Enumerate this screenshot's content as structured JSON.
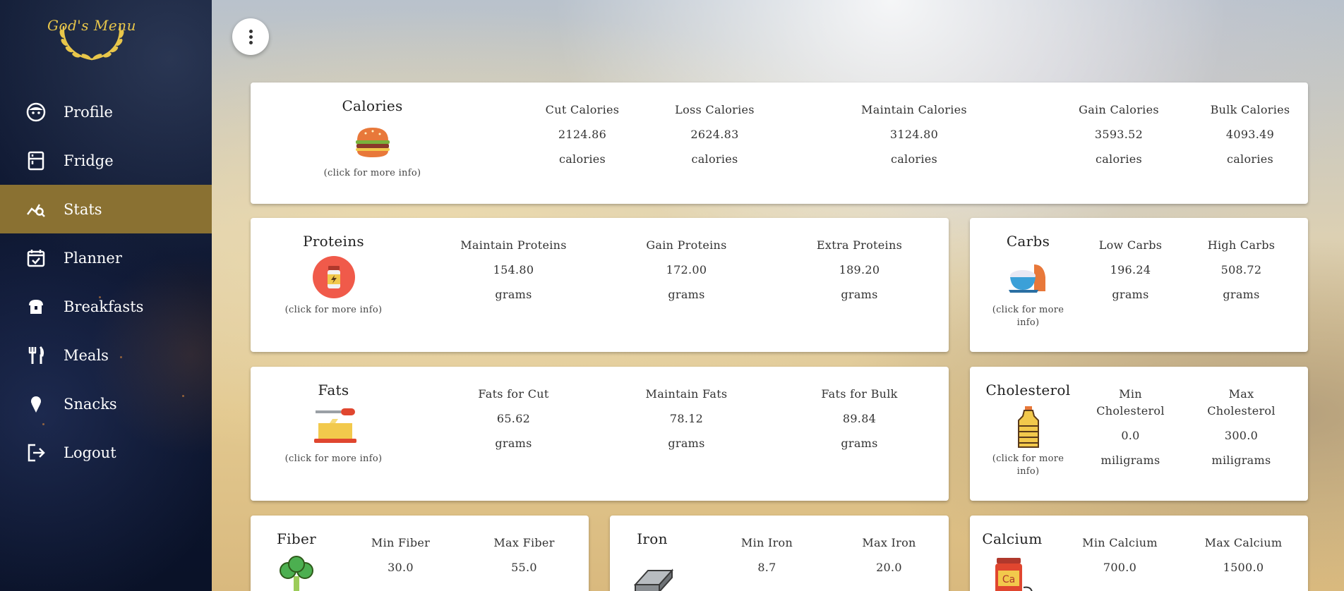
{
  "app": {
    "logo_text": "God's Menu"
  },
  "sidebar": {
    "items": [
      {
        "label": "Profile",
        "icon": "face-icon",
        "active": false
      },
      {
        "label": "Fridge",
        "icon": "fridge-icon",
        "active": false
      },
      {
        "label": "Stats",
        "icon": "stats-icon",
        "active": true
      },
      {
        "label": "Planner",
        "icon": "calendar-check-icon",
        "active": false
      },
      {
        "label": "Breakfasts",
        "icon": "bread-icon",
        "active": false
      },
      {
        "label": "Meals",
        "icon": "fork-knife-icon",
        "active": false
      },
      {
        "label": "Snacks",
        "icon": "ice-cream-icon",
        "active": false
      },
      {
        "label": "Logout",
        "icon": "logout-icon",
        "active": false
      }
    ]
  },
  "colors": {
    "active_nav": "#8a7132",
    "logo_gold": "#e8c64a",
    "sidebar_bg": "#0d1630"
  },
  "more_info": "(click for more info)",
  "calories": {
    "title": "Calories",
    "cols": [
      {
        "label": "Cut Calories",
        "value": "2124.86",
        "unit": "calories"
      },
      {
        "label": "Loss Calories",
        "value": "2624.83",
        "unit": "calories"
      },
      {
        "label": "Maintain Calories",
        "value": "3124.80",
        "unit": "calories"
      },
      {
        "label": "Gain Calories",
        "value": "3593.52",
        "unit": "calories"
      },
      {
        "label": "Bulk Calories",
        "value": "4093.49",
        "unit": "calories"
      }
    ]
  },
  "proteins": {
    "title": "Proteins",
    "cols": [
      {
        "label": "Maintain Proteins",
        "value": "154.80",
        "unit": "grams"
      },
      {
        "label": "Gain Proteins",
        "value": "172.00",
        "unit": "grams"
      },
      {
        "label": "Extra Proteins",
        "value": "189.20",
        "unit": "grams"
      }
    ]
  },
  "carbs": {
    "title": "Carbs",
    "more_line1": "(click for more",
    "more_line2": "info)",
    "cols": [
      {
        "label": "Low Carbs",
        "value": "196.24",
        "unit": "grams"
      },
      {
        "label": "High Carbs",
        "value": "508.72",
        "unit": "grams"
      }
    ]
  },
  "fats": {
    "title": "Fats",
    "cols": [
      {
        "label": "Fats for Cut",
        "value": "65.62",
        "unit": "grams"
      },
      {
        "label": "Maintain Fats",
        "value": "78.12",
        "unit": "grams"
      },
      {
        "label": "Fats for Bulk",
        "value": "89.84",
        "unit": "grams"
      }
    ]
  },
  "cholesterol": {
    "title": "Cholesterol",
    "more_line1": "(click for more",
    "more_line2": "info)",
    "cols": [
      {
        "label1": "Min",
        "label2": "Cholesterol",
        "value": "0.0",
        "unit": "miligrams"
      },
      {
        "label1": "Max",
        "label2": "Cholesterol",
        "value": "300.0",
        "unit": "miligrams"
      }
    ]
  },
  "fiber": {
    "title": "Fiber",
    "cols": [
      {
        "label": "Min Fiber",
        "value": "30.0"
      },
      {
        "label": "Max Fiber",
        "value": "55.0"
      }
    ]
  },
  "iron": {
    "title": "Iron",
    "cols": [
      {
        "label": "Min Iron",
        "value": "8.7"
      },
      {
        "label": "Max Iron",
        "value": "20.0"
      }
    ]
  },
  "calcium": {
    "title": "Calcium",
    "cols": [
      {
        "label": "Min Calcium",
        "value": "700.0"
      },
      {
        "label": "Max Calcium",
        "value": "1500.0"
      }
    ]
  }
}
